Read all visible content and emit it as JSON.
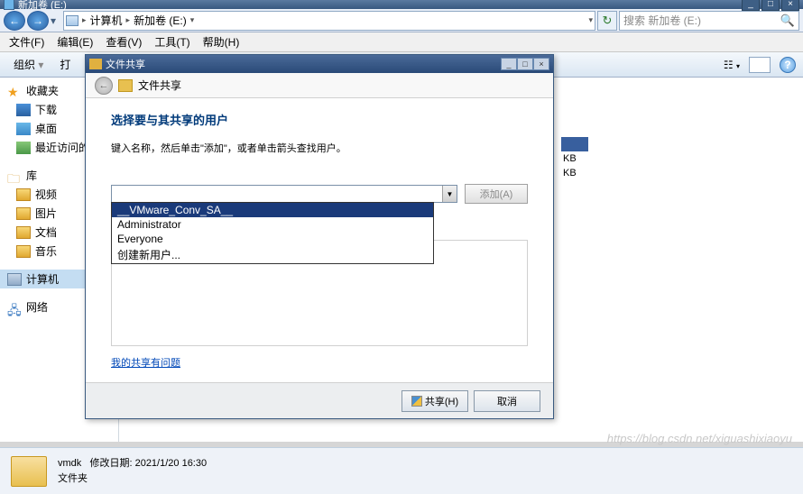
{
  "window": {
    "title": "新加卷 (E:)",
    "breadcrumb": [
      "计算机",
      "新加卷 (E:)"
    ],
    "search_placeholder": "搜索 新加卷 (E:)"
  },
  "menubar": [
    "文件(F)",
    "编辑(E)",
    "查看(V)",
    "工具(T)",
    "帮助(H)"
  ],
  "toolbar": {
    "organize": "组织",
    "open": "打"
  },
  "sidebar": {
    "favorites": {
      "label": "收藏夹",
      "items": [
        "下载",
        "桌面",
        "最近访问的"
      ]
    },
    "libraries": {
      "label": "库",
      "items": [
        "视频",
        "图片",
        "文档",
        "音乐"
      ]
    },
    "computer": "计算机",
    "network": "网络"
  },
  "content_items": [
    {
      "size": "KB"
    },
    {
      "size": "KB"
    }
  ],
  "statusbar": {
    "name": "vmdk",
    "date_label": "修改日期:",
    "date": "2021/1/20 16:30",
    "type": "文件夹"
  },
  "dialog": {
    "title": "文件共享",
    "header": "文件共享",
    "heading": "选择要与其共享的用户",
    "instruction": "键入名称，然后单击\"添加\"，或者单击箭头查找用户。",
    "add_btn": "添加(A)",
    "options": [
      "__VMware_Conv_SA__",
      "Administrator",
      "Everyone",
      "创建新用户..."
    ],
    "help_link": "我的共享有问题",
    "share_btn": "共享(H)",
    "cancel_btn": "取消"
  },
  "watermark": "https://blog.csdn.net/xiguashixiaoyu"
}
